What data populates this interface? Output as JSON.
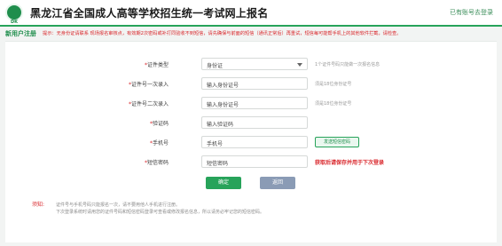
{
  "header": {
    "logo_text": "DK",
    "title": "黑龙江省全国成人高等学校招生统一考试网上报名",
    "top_link": "已有账号去登录"
  },
  "breadcrumb": "新用户注册",
  "notice": "提示：无身份证请联系 现场报名审核点，有效期2次密码或补打同验收不到短信，请先确保与前面的短信（通讯正常后）再重试，短信每可能帮手机上的其他软件拦截，请检查。",
  "form": {
    "id_type": {
      "label": "证件类型",
      "value": "身份证",
      "hint": "1个证件号码只能做一次报名信息"
    },
    "id_number_1": {
      "label": "证件号一次录入",
      "placeholder": "输入身份证号",
      "hint": "须是18位身份证号"
    },
    "id_number_2": {
      "label": "证件号二次录入",
      "placeholder": "输入身份证号",
      "hint": "须是18位身份证号"
    },
    "captcha": {
      "label": "验证码",
      "placeholder": "输入验证码"
    },
    "phone": {
      "label": "手机号",
      "placeholder": "手机号",
      "button": "发送短信密码"
    },
    "sms_password": {
      "label": "短信密码",
      "placeholder": "短信密码",
      "hint": "获取后请保存并用于下次登录"
    }
  },
  "buttons": {
    "ok": "确定",
    "back": "返回"
  },
  "notes": {
    "label": "须知:",
    "lines": [
      "证件号与手机号码只能报名一次，请不要用他人手机进行注册。",
      "下次登录系统时请用您的证件号码和短信密码登录可查看或修改报名信息，所以请务必牢记您的短信密码。"
    ]
  },
  "colors": {
    "brand_green": "#27a35a",
    "warning_red": "#d9262b",
    "back_button": "#8a9bb5"
  }
}
